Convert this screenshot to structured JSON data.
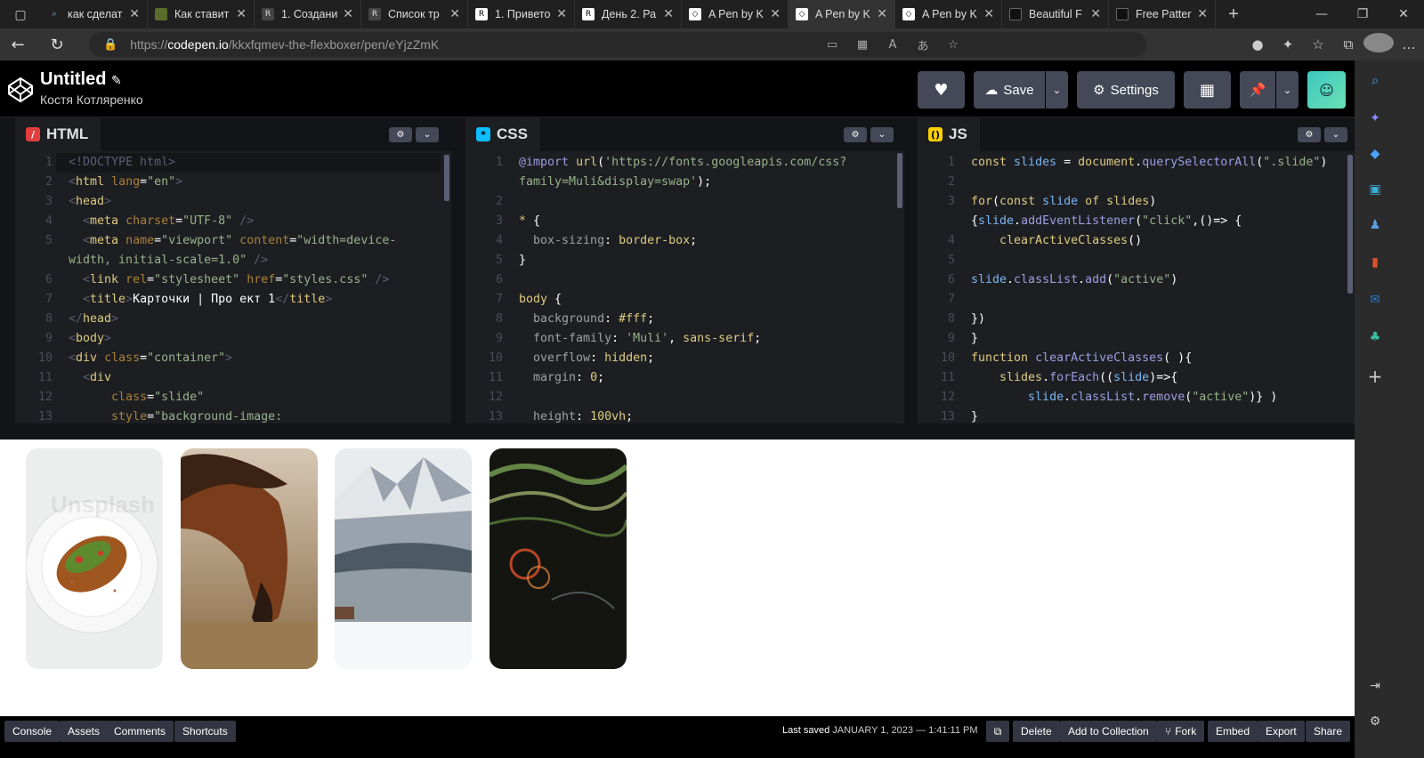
{
  "browser": {
    "tabs": [
      {
        "title": "как сделат",
        "icon": "search-icon",
        "active": false
      },
      {
        "title": "Как ставит",
        "icon": "site-icon",
        "active": false
      },
      {
        "title": "1. Создани",
        "icon": "r-icon",
        "active": false
      },
      {
        "title": "Список тр",
        "icon": "r-icon",
        "active": false
      },
      {
        "title": "1. Привето",
        "icon": "r-icon",
        "active": false
      },
      {
        "title": "День 2. Ра",
        "icon": "r-icon",
        "active": false
      },
      {
        "title": "A Pen by K",
        "icon": "codepen-icon",
        "active": false
      },
      {
        "title": "A Pen by K",
        "icon": "codepen-icon",
        "active": true
      },
      {
        "title": "A Pen by K",
        "icon": "codepen-icon",
        "active": false
      },
      {
        "title": "Beautiful F",
        "icon": "site-icon",
        "active": false
      },
      {
        "title": "Free Patter",
        "icon": "site-icon",
        "active": false
      }
    ],
    "url_host": "codepen.io",
    "url_protocol": "https://",
    "url_path": "/kkxfqmev-the-flexboxer/pen/eYjzZmK"
  },
  "pen": {
    "title": "Untitled",
    "author": "Костя Котляренко",
    "save_label": "Save",
    "settings_label": "Settings"
  },
  "editors": {
    "html": {
      "label": "HTML",
      "line_numbers": [
        "1",
        "2",
        "3",
        "4",
        "5",
        "",
        "6",
        "7",
        "8",
        "9",
        "10",
        "11",
        "12",
        "13"
      ]
    },
    "css": {
      "label": "CSS",
      "line_numbers": [
        "1",
        "",
        "2",
        "3",
        "4",
        "5",
        "6",
        "7",
        "8",
        "9",
        "10",
        "11",
        "12",
        "13"
      ]
    },
    "js": {
      "label": "JS",
      "line_numbers": [
        "1",
        "2",
        "3",
        "",
        "4",
        "5",
        "6",
        "7",
        "8",
        "9",
        "10",
        "11",
        "12",
        "13"
      ]
    }
  },
  "footer": {
    "console": "Console",
    "assets": "Assets",
    "comments": "Comments",
    "shortcuts": "Shortcuts",
    "last_saved_label": "Last saved",
    "last_saved_date": "JANUARY 1, 2023 — 1:41:11 PM",
    "delete": "Delete",
    "add_to_collection": "Add to Collection",
    "fork": "Fork",
    "embed": "Embed",
    "export": "Export",
    "share": "Share"
  },
  "preview": {
    "overlay_text": "Unsplash",
    "slides": [
      "food-image",
      "horse-image",
      "mountain-image",
      "lights-image"
    ]
  },
  "colors": {
    "html_icon": "#e33e3e",
    "css_icon": "#0ebeff",
    "js_icon": "#fcd000",
    "button_bg": "#444857"
  }
}
